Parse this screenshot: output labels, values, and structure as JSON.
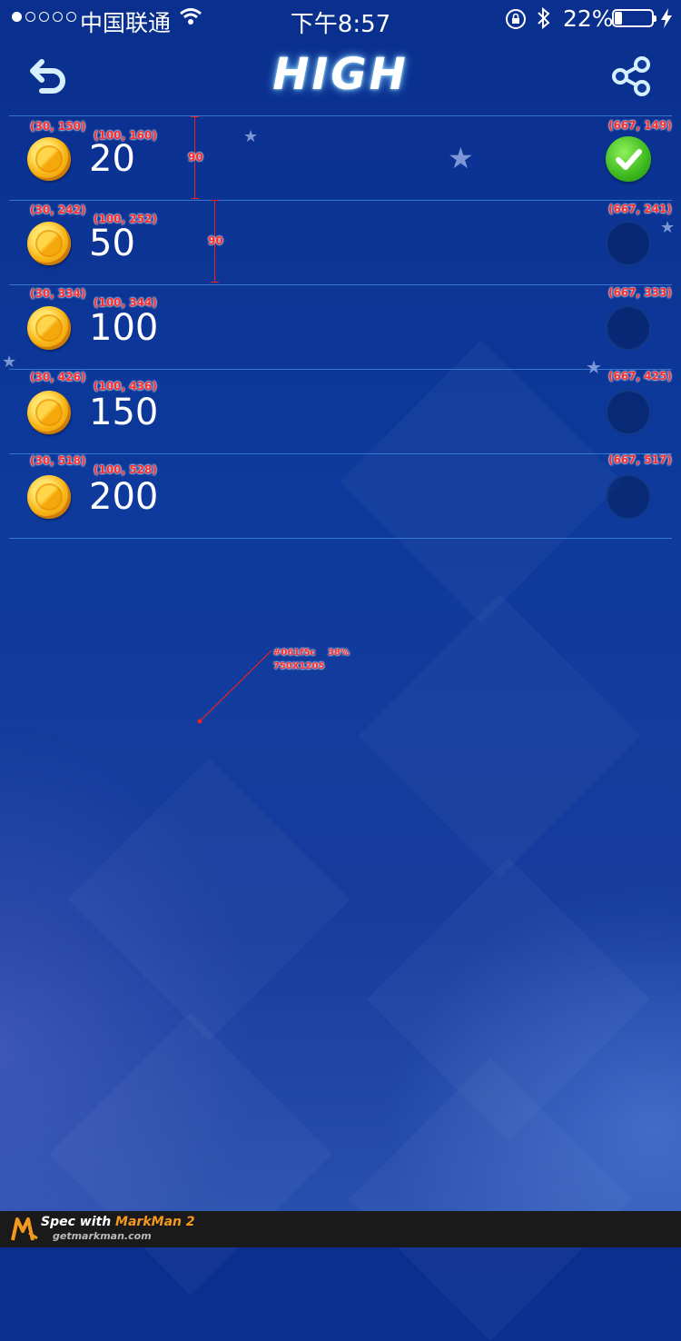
{
  "status_bar": {
    "carrier": "中国联通",
    "time": "下午8:57",
    "battery": "22%",
    "battery_level": 0.22
  },
  "header": {
    "title": "HIGH",
    "back_icon": "back-arrow-icon",
    "share_icon": "share-icon"
  },
  "options": [
    {
      "amount": "20",
      "selected": true
    },
    {
      "amount": "50",
      "selected": false
    },
    {
      "amount": "100",
      "selected": false
    },
    {
      "amount": "150",
      "selected": false
    },
    {
      "amount": "200",
      "selected": false
    }
  ],
  "annotations": {
    "coins": [
      "(30, 150)",
      "(30, 242)",
      "(30, 334)",
      "(30, 426)",
      "(30, 518)"
    ],
    "amounts": [
      "(100, 160)",
      "(100, 252)",
      "(100, 344)",
      "(100, 436)",
      "(100, 528)"
    ],
    "radios": [
      "(667, 149)",
      "(667, 241)",
      "(667, 333)",
      "(667, 425)",
      "(667, 517)"
    ],
    "spacing": [
      "90",
      "90"
    ],
    "bg_color": "#061f5c",
    "bg_opacity": "38%",
    "bg_size": "750X1205"
  },
  "footer": {
    "spec_prefix": "Spec with",
    "brand": "MarkMan 2",
    "url": "getmarkman.com"
  },
  "colors": {
    "background": "#0d3a9c",
    "divider": "#4a9aff",
    "check": "#3cb81e",
    "coin": "#f7b314",
    "annotation": "#ff2a2a"
  }
}
